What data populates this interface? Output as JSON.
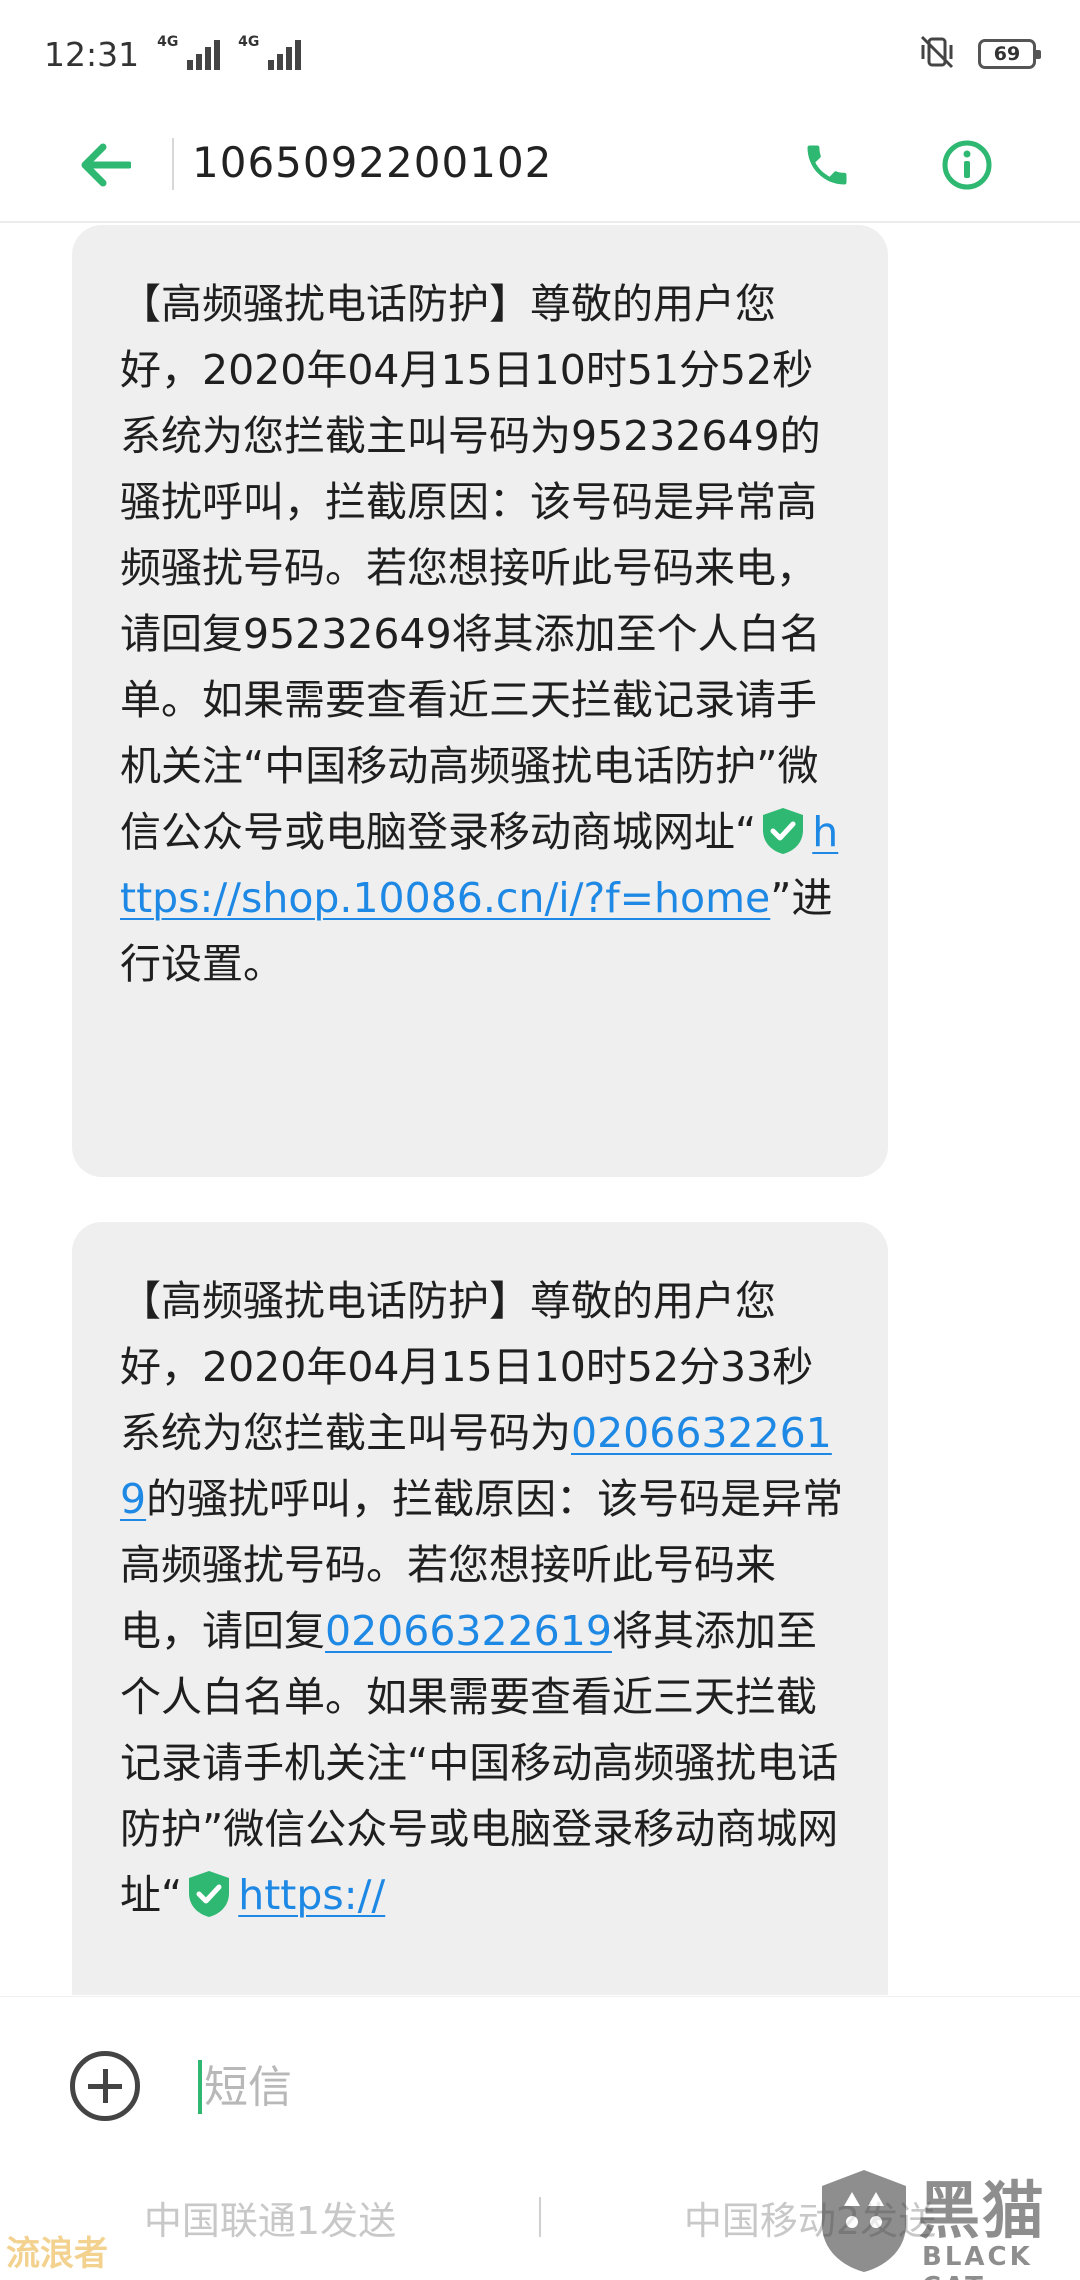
{
  "status_bar": {
    "time": "12:31",
    "network_1": "4G",
    "network_2": "4G",
    "battery": "69"
  },
  "header": {
    "contact_number": "1065092200102",
    "accent_color": "#2eb872"
  },
  "messages": [
    {
      "seg1": "【高频骚扰电话防护】尊敬的用户您好，2020年04月15日10时51分52秒系统为您拦截主叫号码为95232649的骚扰呼叫，拦截原因：该号码是异常高频骚扰号码。若您想接听此号码来电，请回复95232649将其添加至个人白名单。如果需要查看近三天拦截记录请手机关注“中国移动高频骚扰电话防护”微信公众号或电脑登录移动商城网址“",
      "link": "https://shop.10086.cn/i/?f=home",
      "seg2": "”进行设置。"
    },
    {
      "seg1": "【高频骚扰电话防护】尊敬的用户您好，2020年04月15日10时52分33秒系统为您拦截主叫号码为",
      "phone_link_1": "02066322619",
      "seg2": "的骚扰呼叫，拦截原因：该号码是异常高频骚扰号码。若您想接听此号码来电，请回复",
      "phone_link_2": "02066322619",
      "seg3": "将其添加至个人白名单。如果需要查看近三天拦截记录请手机关注“中国移动高频骚扰电话防护”微信公众号或电脑登录移动商城网址“",
      "link": "https://"
    }
  ],
  "compose": {
    "placeholder": "短信",
    "sim1_label": "中国联通1发送",
    "sim2_label": "中国移动2发送"
  },
  "watermarks": {
    "left": "流浪者",
    "right_cn": "黑猫",
    "right_en": "BLACK CAT"
  }
}
